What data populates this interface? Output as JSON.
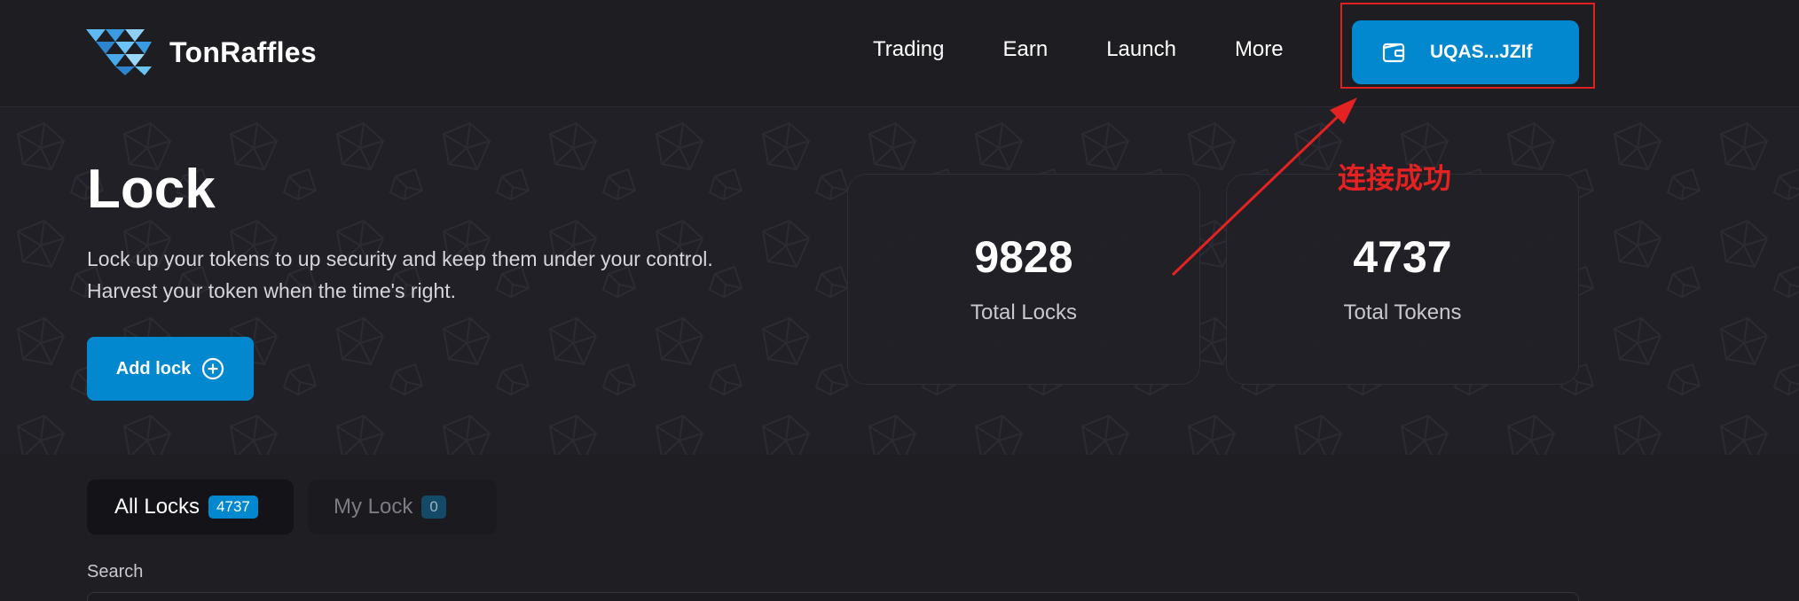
{
  "brand": {
    "name": "TonRaffles"
  },
  "nav": {
    "items": [
      "Trading",
      "Earn",
      "Launch",
      "More"
    ]
  },
  "wallet": {
    "address": "UQAS...JZIf",
    "icon": "wallet-icon"
  },
  "hero": {
    "title": "Lock",
    "subtitle_line1": "Lock up your tokens to up security and keep them under your control.",
    "subtitle_line2": "Harvest your token when the time's right.",
    "add_lock_label": "Add lock",
    "add_lock_icon": "plus-circle-icon"
  },
  "stats": [
    {
      "value": "9828",
      "label": "Total Locks"
    },
    {
      "value": "4737",
      "label": "Total Tokens"
    }
  ],
  "annotation": {
    "text": "连接成功",
    "color": "#e52222"
  },
  "tabs": [
    {
      "label": "All Locks",
      "badge": "4737",
      "active": true
    },
    {
      "label": "My Lock",
      "badge": "0",
      "active": false
    }
  ],
  "search": {
    "label": "Search",
    "placeholder": ""
  },
  "colors": {
    "accent": "#0288cf",
    "background": "#1e1e23",
    "highlight": "#e02020"
  }
}
